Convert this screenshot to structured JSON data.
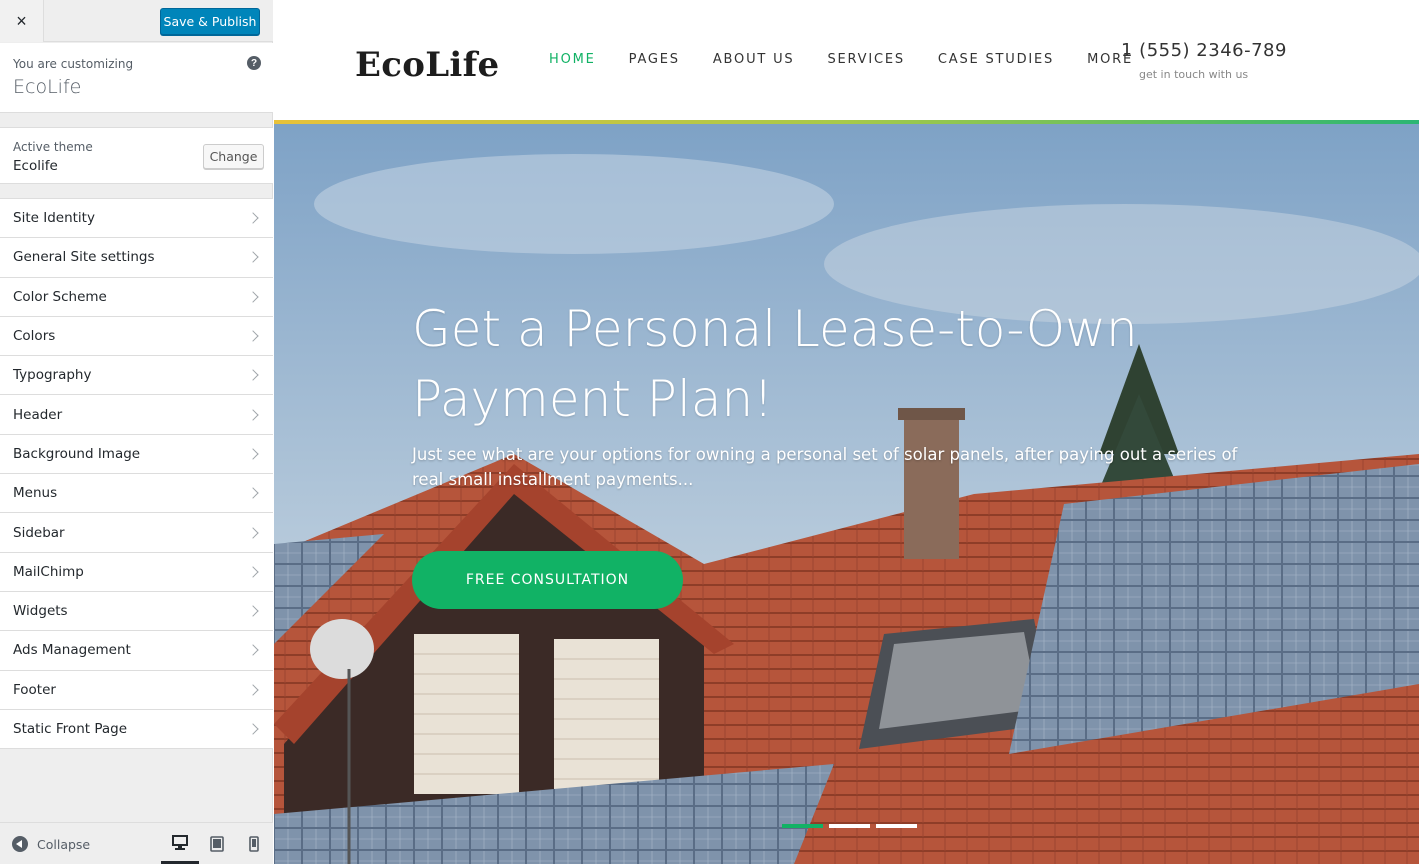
{
  "customizer": {
    "close_label": "×",
    "publish_label": "Save & Publish",
    "customizing_label": "You are customizing",
    "site_name": "EcoLife",
    "help_label": "?",
    "active_theme_label": "Active theme",
    "active_theme_name": "Ecolife",
    "change_label": "Change",
    "sections": [
      "Site Identity",
      "General Site settings",
      "Color Scheme",
      "Colors",
      "Typography",
      "Header",
      "Background Image",
      "Menus",
      "Sidebar",
      "MailChimp",
      "Widgets",
      "Ads Management",
      "Footer",
      "Static Front Page"
    ],
    "collapse_label": "Collapse",
    "devices": [
      "desktop-icon",
      "tablet-icon",
      "mobile-icon"
    ],
    "active_device": "desktop"
  },
  "site": {
    "logo": "EcoLife",
    "nav": [
      "HOME",
      "PAGES",
      "ABOUT US",
      "SERVICES",
      "CASE STUDIES",
      "MORE"
    ],
    "active_nav": "HOME",
    "phone": "1 (555) 2346-789",
    "phone_sub": "get in touch with us",
    "hero": {
      "title": "Get a Personal Lease-to-Own Payment Plan!",
      "text": "Just see what are your options for owning a personal set of solar panels, after paying out a series of real small installment payments...",
      "cta": "FREE CONSULTATION",
      "slides": 3,
      "active_slide": 1
    }
  },
  "colors": {
    "accent": "#11b265",
    "publish": "#0085ba",
    "roof": "#b5543a",
    "sky": "#8fb2d4"
  }
}
